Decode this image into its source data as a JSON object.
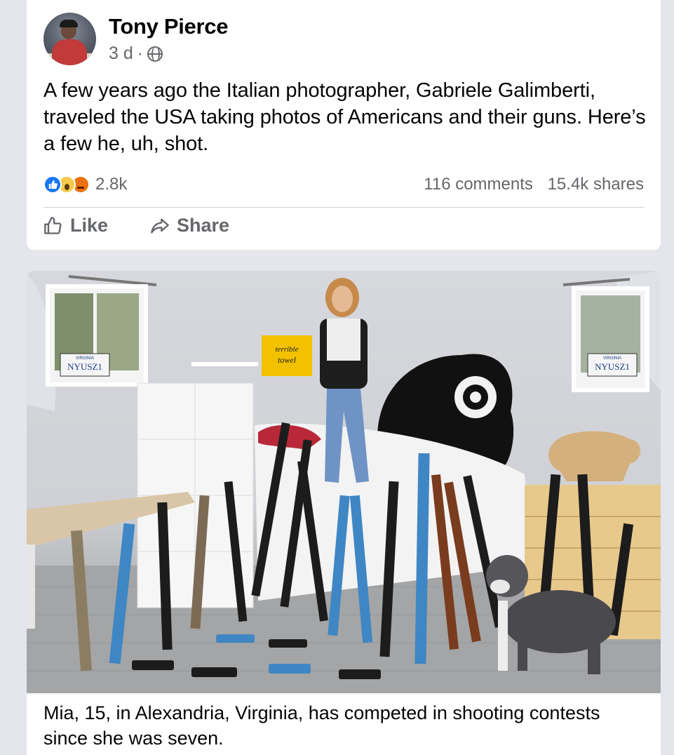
{
  "post": {
    "author": "Tony Pierce",
    "time": "3 d",
    "separator": "·",
    "privacy_icon": "globe-icon",
    "text": "A few years ago the Italian photographer, Gabriele Galimberti, traveled the USA taking photos of Americans and their guns. Here’s a few he, uh, shot.",
    "reactions": {
      "icons": [
        "like-icon",
        "wow-icon",
        "angry-icon"
      ],
      "count": "2.8k"
    },
    "comments": "116 comments",
    "shares": "15.4k shares",
    "actions": {
      "like_label": "Like",
      "share_label": "Share"
    }
  },
  "photo": {
    "license_plate_left": "NYUSZ1",
    "license_plate_right": "NYUSZ1",
    "plate_state": "VIRGINIA",
    "towel_text_1": "terrible",
    "towel_text_2": "towel",
    "caption": "Mia, 15, in Alexandria, Virginia, has competed in shooting contests since she was seven."
  },
  "colors": {
    "page_bg": "#e4e6eb",
    "card_bg": "#ffffff",
    "secondary_text": "#65676b",
    "like_blue": "#1877f2"
  }
}
